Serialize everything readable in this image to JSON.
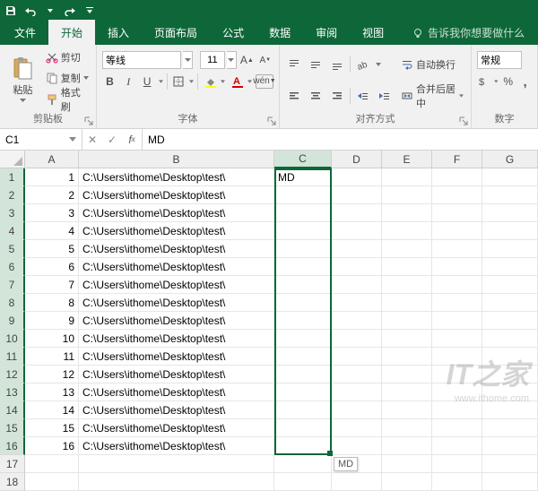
{
  "qat": {
    "save": "save-icon",
    "undo": "undo-icon",
    "redo": "redo-icon"
  },
  "tabs": {
    "file": "文件",
    "home": "开始",
    "insert": "插入",
    "layout": "页面布局",
    "formulas": "公式",
    "data": "数据",
    "review": "审阅",
    "view": "视图",
    "tellme": "告诉我你想要做什么"
  },
  "ribbon": {
    "clipboard": {
      "paste": "粘贴",
      "cut": "剪切",
      "copy": "复制",
      "formatpainter": "格式刷",
      "label": "剪贴板"
    },
    "font": {
      "name": "等线",
      "size": "11",
      "label": "字体"
    },
    "alignment": {
      "wrap": "自动换行",
      "merge": "合并后居中",
      "label": "对齐方式"
    },
    "number": {
      "format": "常规",
      "label": "数字"
    }
  },
  "formulabar": {
    "ref": "C1",
    "value": "MD"
  },
  "grid": {
    "cols": [
      "A",
      "B",
      "C",
      "D",
      "E",
      "F",
      "G"
    ],
    "activeCol": "C",
    "path": "C:\\Users\\ithome\\Desktop\\test\\",
    "c1": "MD",
    "tooltip": "MD",
    "rowCount": 18,
    "dataRows": 16
  },
  "watermark": {
    "logo": "IT之家",
    "url": "www.ithome.com"
  }
}
